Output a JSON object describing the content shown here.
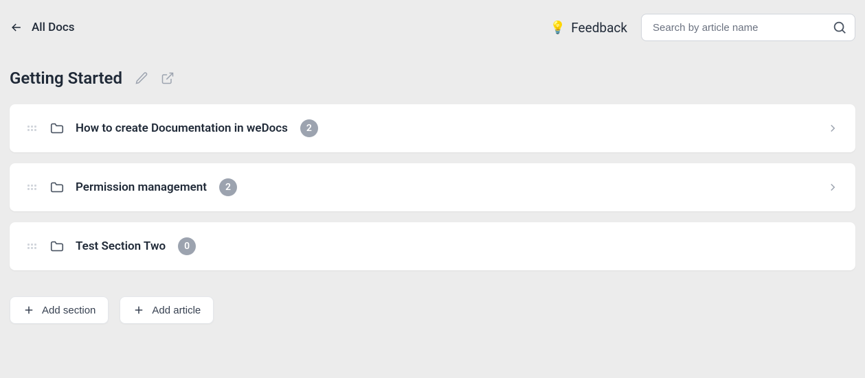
{
  "nav": {
    "back_label": "All Docs"
  },
  "feedback": {
    "label": "Feedback",
    "icon": "💡"
  },
  "search": {
    "placeholder": "Search by article name"
  },
  "page": {
    "title": "Getting Started"
  },
  "sections": [
    {
      "title": "How to create Documentation in weDocs",
      "count": "2",
      "has_children": true
    },
    {
      "title": "Permission management",
      "count": "2",
      "has_children": true
    },
    {
      "title": "Test Section Two",
      "count": "0",
      "has_children": false
    }
  ],
  "actions": {
    "add_section": "Add section",
    "add_article": "Add article"
  }
}
